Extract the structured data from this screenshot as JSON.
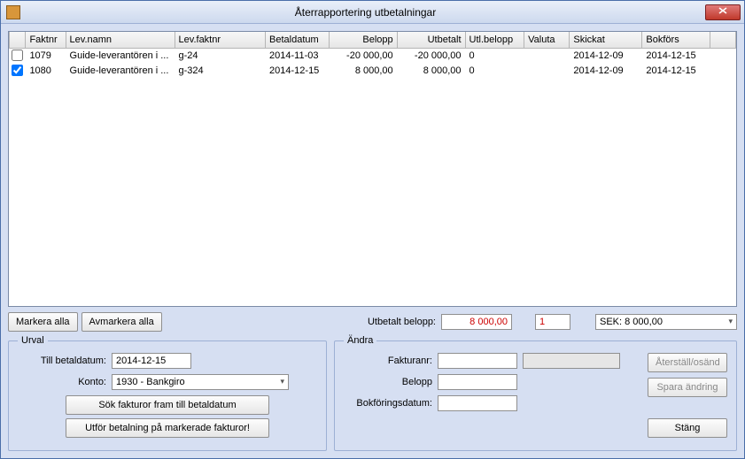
{
  "window": {
    "title": "Återrapportering utbetalningar"
  },
  "columns": {
    "faktnr": "Faktnr",
    "levnamn": "Lev.namn",
    "levfaktnr": "Lev.faktnr",
    "betaldatum": "Betaldatum",
    "belopp": "Belopp",
    "utbetalt": "Utbetalt",
    "utlbelopp": "Utl.belopp",
    "valuta": "Valuta",
    "skickat": "Skickat",
    "bokfors": "Bokförs"
  },
  "rows": [
    {
      "checked": false,
      "faktnr": "1079",
      "levnamn": "Guide-leverantören i ...",
      "levfaktnr": "g-24",
      "betaldatum": "2014-11-03",
      "belopp": "-20 000,00",
      "utbetalt": "-20 000,00",
      "utlbelopp": "0",
      "valuta": "",
      "skickat": "2014-12-09",
      "bokfors": "2014-12-15"
    },
    {
      "checked": true,
      "faktnr": "1080",
      "levnamn": "Guide-leverantören i ...",
      "levfaktnr": "g-324",
      "betaldatum": "2014-12-15",
      "belopp": "8 000,00",
      "utbetalt": "8 000,00",
      "utlbelopp": "0",
      "valuta": "",
      "skickat": "2014-12-09",
      "bokfors": "2014-12-15"
    }
  ],
  "buttons": {
    "markera_alla": "Markera alla",
    "avmarkera_alla": "Avmarkera alla",
    "sok_fakturor": "Sök fakturor fram till betaldatum",
    "utfor_betalning": "Utför betalning på markerade fakturor!",
    "aterstall": "Återställ/osänd",
    "spara": "Spara ändring",
    "stang": "Stäng"
  },
  "summary": {
    "utbetalt_label": "Utbetalt belopp:",
    "utbetalt_value": "8 000,00",
    "count": "1",
    "sek_text": "SEK: 8 000,00"
  },
  "urval": {
    "legend": "Urval",
    "till_betaldatum_label": "Till betaldatum:",
    "till_betaldatum_value": "2014-12-15",
    "konto_label": "Konto:",
    "konto_value": "1930            - Bankgiro"
  },
  "andra": {
    "legend": "Ändra",
    "fakturanr_label": "Fakturanr:",
    "fakturanr_value": "",
    "belopp_label": "Belopp",
    "belopp_value": "",
    "bokforingsdatum_label": "Bokföringsdatum:",
    "bokforingsdatum_value": ""
  }
}
